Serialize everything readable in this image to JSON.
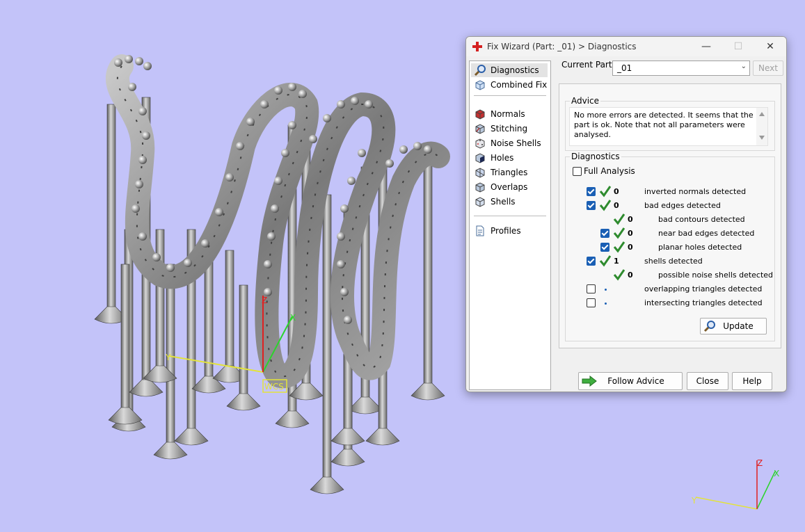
{
  "window": {
    "title": "Fix Wizard (Part: _01) > Diagnostics",
    "minimize_glyph": "—",
    "maximize_glyph": "☐",
    "close_glyph": "✕",
    "title_icon": "red-cross-icon"
  },
  "sidebar": {
    "items": [
      {
        "label": "Diagnostics",
        "icon": "magnifier-icon",
        "selected": true
      },
      {
        "label": "Combined Fix",
        "icon": "cubes-icon"
      },
      {
        "label": "Normals",
        "icon": "normals-cube-icon"
      },
      {
        "label": "Stitching",
        "icon": "stitching-cube-icon"
      },
      {
        "label": "Noise Shells",
        "icon": "noise-dice-icon"
      },
      {
        "label": "Holes",
        "icon": "holes-cube-icon"
      },
      {
        "label": "Triangles",
        "icon": "triangles-cube-icon"
      },
      {
        "label": "Overlaps",
        "icon": "overlaps-cube-icon"
      },
      {
        "label": "Shells",
        "icon": "shells-cube-icon"
      },
      {
        "label": "Profiles",
        "icon": "document-icon"
      }
    ]
  },
  "part": {
    "label": "Current Part:",
    "value": "_01",
    "next_label": "Next"
  },
  "advice": {
    "title": "Advice",
    "text": "No more errors are detected. It seems that the part is ok. Note that not all parameters were analysed."
  },
  "diagnostics": {
    "title": "Diagnostics",
    "full_analysis_label": "Full Analysis",
    "full_analysis_checked": false,
    "rows": [
      {
        "checked": true,
        "ok": true,
        "count": "0",
        "label": "inverted normals detected"
      },
      {
        "checked": true,
        "ok": true,
        "count": "0",
        "label": "bad edges detected"
      },
      {
        "checked": null,
        "ok": true,
        "count": "0",
        "label": "bad contours detected"
      },
      {
        "checked": true,
        "ok": true,
        "count": "0",
        "label": "near bad edges detected"
      },
      {
        "checked": true,
        "ok": true,
        "count": "0",
        "label": "planar holes detected"
      },
      {
        "checked": true,
        "ok": true,
        "count": "1",
        "label": "shells detected"
      },
      {
        "checked": null,
        "ok": true,
        "count": "0",
        "label": "possible noise shells detected"
      },
      {
        "checked": false,
        "ok": false,
        "count": "",
        "label": "overlapping triangles detected"
      },
      {
        "checked": false,
        "ok": false,
        "count": "",
        "label": "intersecting triangles detected"
      }
    ],
    "update_label": "Update"
  },
  "buttons": {
    "follow_advice": "Follow Advice",
    "close": "Close",
    "help": "Help"
  },
  "viewport": {
    "labels": {
      "wcs": "WCS",
      "y": "Y",
      "x": "X",
      "z": "Z"
    },
    "colors": {
      "background": "#c3c3f9",
      "model": "#8a8a8a",
      "axis_x": "#2bd42b",
      "axis_y": "#e3e33a",
      "axis_z": "#e02020"
    }
  },
  "colors": {
    "check_blue": "#1a5fb4",
    "tick_green": "#2e8b2e"
  }
}
